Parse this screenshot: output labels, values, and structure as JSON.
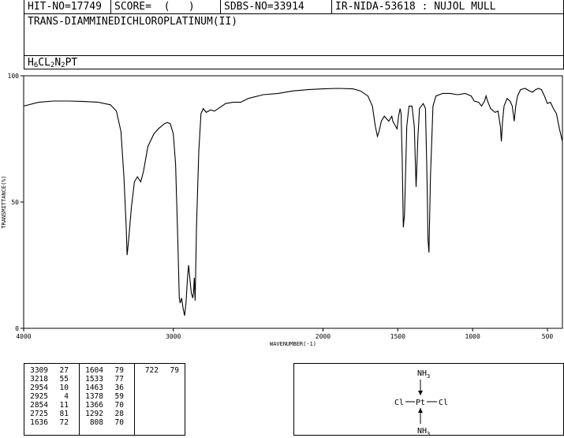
{
  "header": {
    "hit_no": "HIT-NO=17749",
    "score": "SCORE=  (   )",
    "sdbs_no": "SDBS-NO=33914",
    "ir_info": "IR-NIDA-53618 : NUJOL MULL"
  },
  "compound_name": "TRANS-DIAMMINEDICHLOROPLATINUM(II)",
  "formula": {
    "parts": [
      {
        "text": "H",
        "sub": false
      },
      {
        "text": "6",
        "sub": true
      },
      {
        "text": "CL",
        "sub": false
      },
      {
        "text": "2",
        "sub": true
      },
      {
        "text": "N",
        "sub": false
      },
      {
        "text": "2",
        "sub": true
      },
      {
        "text": "PT",
        "sub": false
      }
    ]
  },
  "chart_data": {
    "type": "line",
    "xlabel": "WAVENUMBER(-1)",
    "ylabel": "TRANSMITTANCE(%)",
    "xlim": [
      4000,
      400
    ],
    "ylim": [
      0,
      100
    ],
    "x_ticks": [
      4000,
      3000,
      2000,
      1500,
      1000,
      500
    ],
    "y_ticks": [
      0,
      50,
      100
    ],
    "series": [
      {
        "points": [
          [
            4000,
            88
          ],
          [
            3900,
            89.5
          ],
          [
            3800,
            90
          ],
          [
            3700,
            90
          ],
          [
            3600,
            89.8
          ],
          [
            3500,
            89.5
          ],
          [
            3420,
            88.5
          ],
          [
            3380,
            86
          ],
          [
            3350,
            78
          ],
          [
            3330,
            60
          ],
          [
            3315,
            40
          ],
          [
            3309,
            29
          ],
          [
            3300,
            34
          ],
          [
            3280,
            48
          ],
          [
            3260,
            58
          ],
          [
            3240,
            60
          ],
          [
            3218,
            58
          ],
          [
            3200,
            62
          ],
          [
            3170,
            72
          ],
          [
            3130,
            77
          ],
          [
            3100,
            79
          ],
          [
            3060,
            81
          ],
          [
            3040,
            81.5
          ],
          [
            3020,
            81
          ],
          [
            3000,
            77
          ],
          [
            2985,
            65
          ],
          [
            2970,
            35
          ],
          [
            2960,
            12
          ],
          [
            2954,
            10
          ],
          [
            2945,
            12
          ],
          [
            2935,
            8
          ],
          [
            2925,
            5
          ],
          [
            2915,
            10
          ],
          [
            2905,
            20
          ],
          [
            2898,
            25
          ],
          [
            2890,
            20
          ],
          [
            2880,
            14
          ],
          [
            2870,
            12
          ],
          [
            2865,
            14
          ],
          [
            2860,
            20
          ],
          [
            2854,
            11
          ],
          [
            2845,
            40
          ],
          [
            2830,
            70
          ],
          [
            2815,
            85
          ],
          [
            2800,
            87
          ],
          [
            2780,
            85.5
          ],
          [
            2750,
            86.5
          ],
          [
            2725,
            86
          ],
          [
            2700,
            87
          ],
          [
            2650,
            89
          ],
          [
            2600,
            89.5
          ],
          [
            2550,
            89.5
          ],
          [
            2500,
            91
          ],
          [
            2400,
            92.5
          ],
          [
            2300,
            93
          ],
          [
            2200,
            94
          ],
          [
            2100,
            94.5
          ],
          [
            2000,
            94.8
          ],
          [
            1900,
            95
          ],
          [
            1800,
            94.8
          ],
          [
            1750,
            94
          ],
          [
            1700,
            92
          ],
          [
            1670,
            88
          ],
          [
            1650,
            80
          ],
          [
            1636,
            76
          ],
          [
            1625,
            78
          ],
          [
            1610,
            82
          ],
          [
            1590,
            84
          ],
          [
            1560,
            82
          ],
          [
            1540,
            84
          ],
          [
            1533,
            82
          ],
          [
            1515,
            80
          ],
          [
            1505,
            79
          ],
          [
            1495,
            84
          ],
          [
            1485,
            87
          ],
          [
            1478,
            85
          ],
          [
            1470,
            65
          ],
          [
            1463,
            40
          ],
          [
            1455,
            45
          ],
          [
            1440,
            80
          ],
          [
            1425,
            88
          ],
          [
            1405,
            88
          ],
          [
            1390,
            80
          ],
          [
            1378,
            56
          ],
          [
            1372,
            65
          ],
          [
            1366,
            75
          ],
          [
            1355,
            87
          ],
          [
            1330,
            89
          ],
          [
            1315,
            87
          ],
          [
            1305,
            60
          ],
          [
            1298,
            35
          ],
          [
            1292,
            30
          ],
          [
            1282,
            60
          ],
          [
            1265,
            88
          ],
          [
            1245,
            92
          ],
          [
            1200,
            93
          ],
          [
            1150,
            93
          ],
          [
            1100,
            92.5
          ],
          [
            1050,
            93
          ],
          [
            1010,
            92
          ],
          [
            990,
            90
          ],
          [
            960,
            89.5
          ],
          [
            940,
            88
          ],
          [
            920,
            90
          ],
          [
            910,
            92
          ],
          [
            900,
            90
          ],
          [
            880,
            87
          ],
          [
            850,
            85.5
          ],
          [
            830,
            86
          ],
          [
            815,
            80
          ],
          [
            808,
            74
          ],
          [
            800,
            82
          ],
          [
            790,
            88
          ],
          [
            770,
            91
          ],
          [
            750,
            90
          ],
          [
            735,
            88
          ],
          [
            722,
            82
          ],
          [
            712,
            88
          ],
          [
            700,
            92
          ],
          [
            680,
            94.5
          ],
          [
            650,
            95
          ],
          [
            620,
            94
          ],
          [
            600,
            93.5
          ],
          [
            580,
            94.5
          ],
          [
            560,
            95
          ],
          [
            540,
            94.5
          ],
          [
            520,
            92
          ],
          [
            500,
            89
          ],
          [
            480,
            89.5
          ],
          [
            460,
            87
          ],
          [
            440,
            85
          ],
          [
            420,
            79
          ],
          [
            400,
            74
          ]
        ]
      }
    ],
    "peak_table": [
      [
        [
          3309,
          27
        ],
        [
          3218,
          55
        ],
        [
          2954,
          10
        ],
        [
          2925,
          4
        ],
        [
          2854,
          11
        ],
        [
          2725,
          81
        ],
        [
          1636,
          72
        ]
      ],
      [
        [
          1604,
          79
        ],
        [
          1533,
          77
        ],
        [
          1463,
          36
        ],
        [
          1378,
          59
        ],
        [
          1366,
          70
        ],
        [
          1292,
          28
        ],
        [
          808,
          70
        ]
      ],
      [
        [
          722,
          79
        ]
      ]
    ]
  },
  "structure": {
    "top_label": "NH",
    "top_sub": "3",
    "bottom_label": "NH",
    "bottom_sub": "3",
    "left_label": "Cl",
    "right_label": "Cl",
    "center_label": "Pt"
  }
}
